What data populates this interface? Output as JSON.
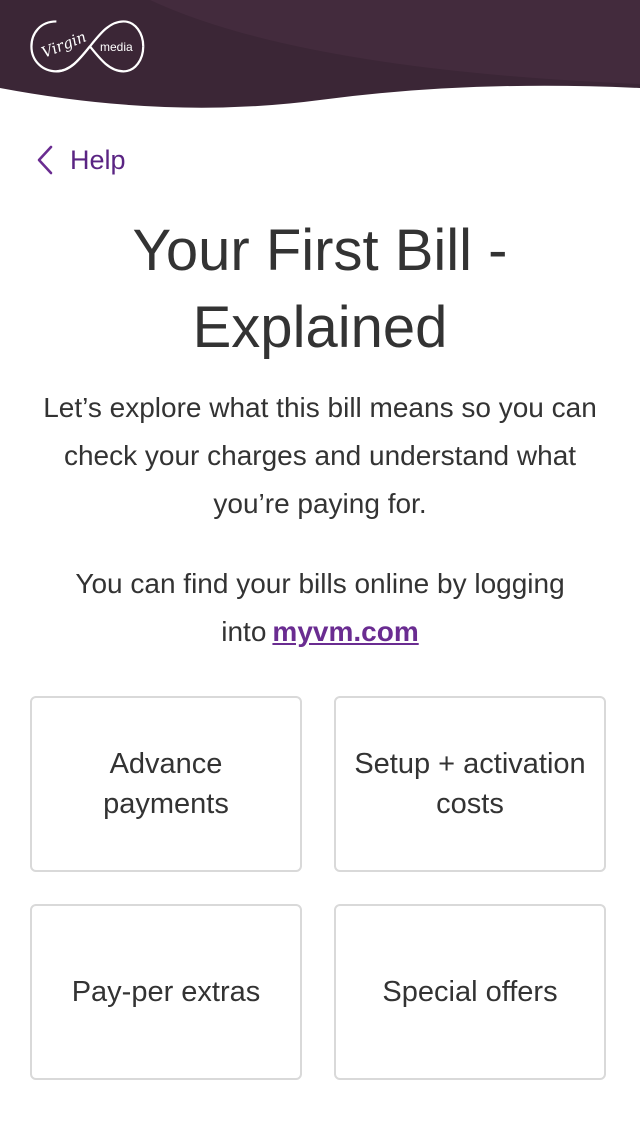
{
  "brand": {
    "logo_script": "Virgin",
    "logo_word": "media",
    "header_color": "#3b2636",
    "accent_color": "#6a2c91"
  },
  "nav": {
    "back_label": "Help",
    "back_icon": "chevron-left-icon"
  },
  "page": {
    "title": "Your First Bill - Explained",
    "intro": "Let’s explore what this bill means so you can check your charges and understand what you’re paying for.",
    "online_text": "You can find your bills online by logging into",
    "online_link": "myvm.com"
  },
  "topics": [
    {
      "label": "Advance payments"
    },
    {
      "label": "Setup + activation costs"
    },
    {
      "label": "Pay-per extras"
    },
    {
      "label": "Special offers"
    }
  ]
}
